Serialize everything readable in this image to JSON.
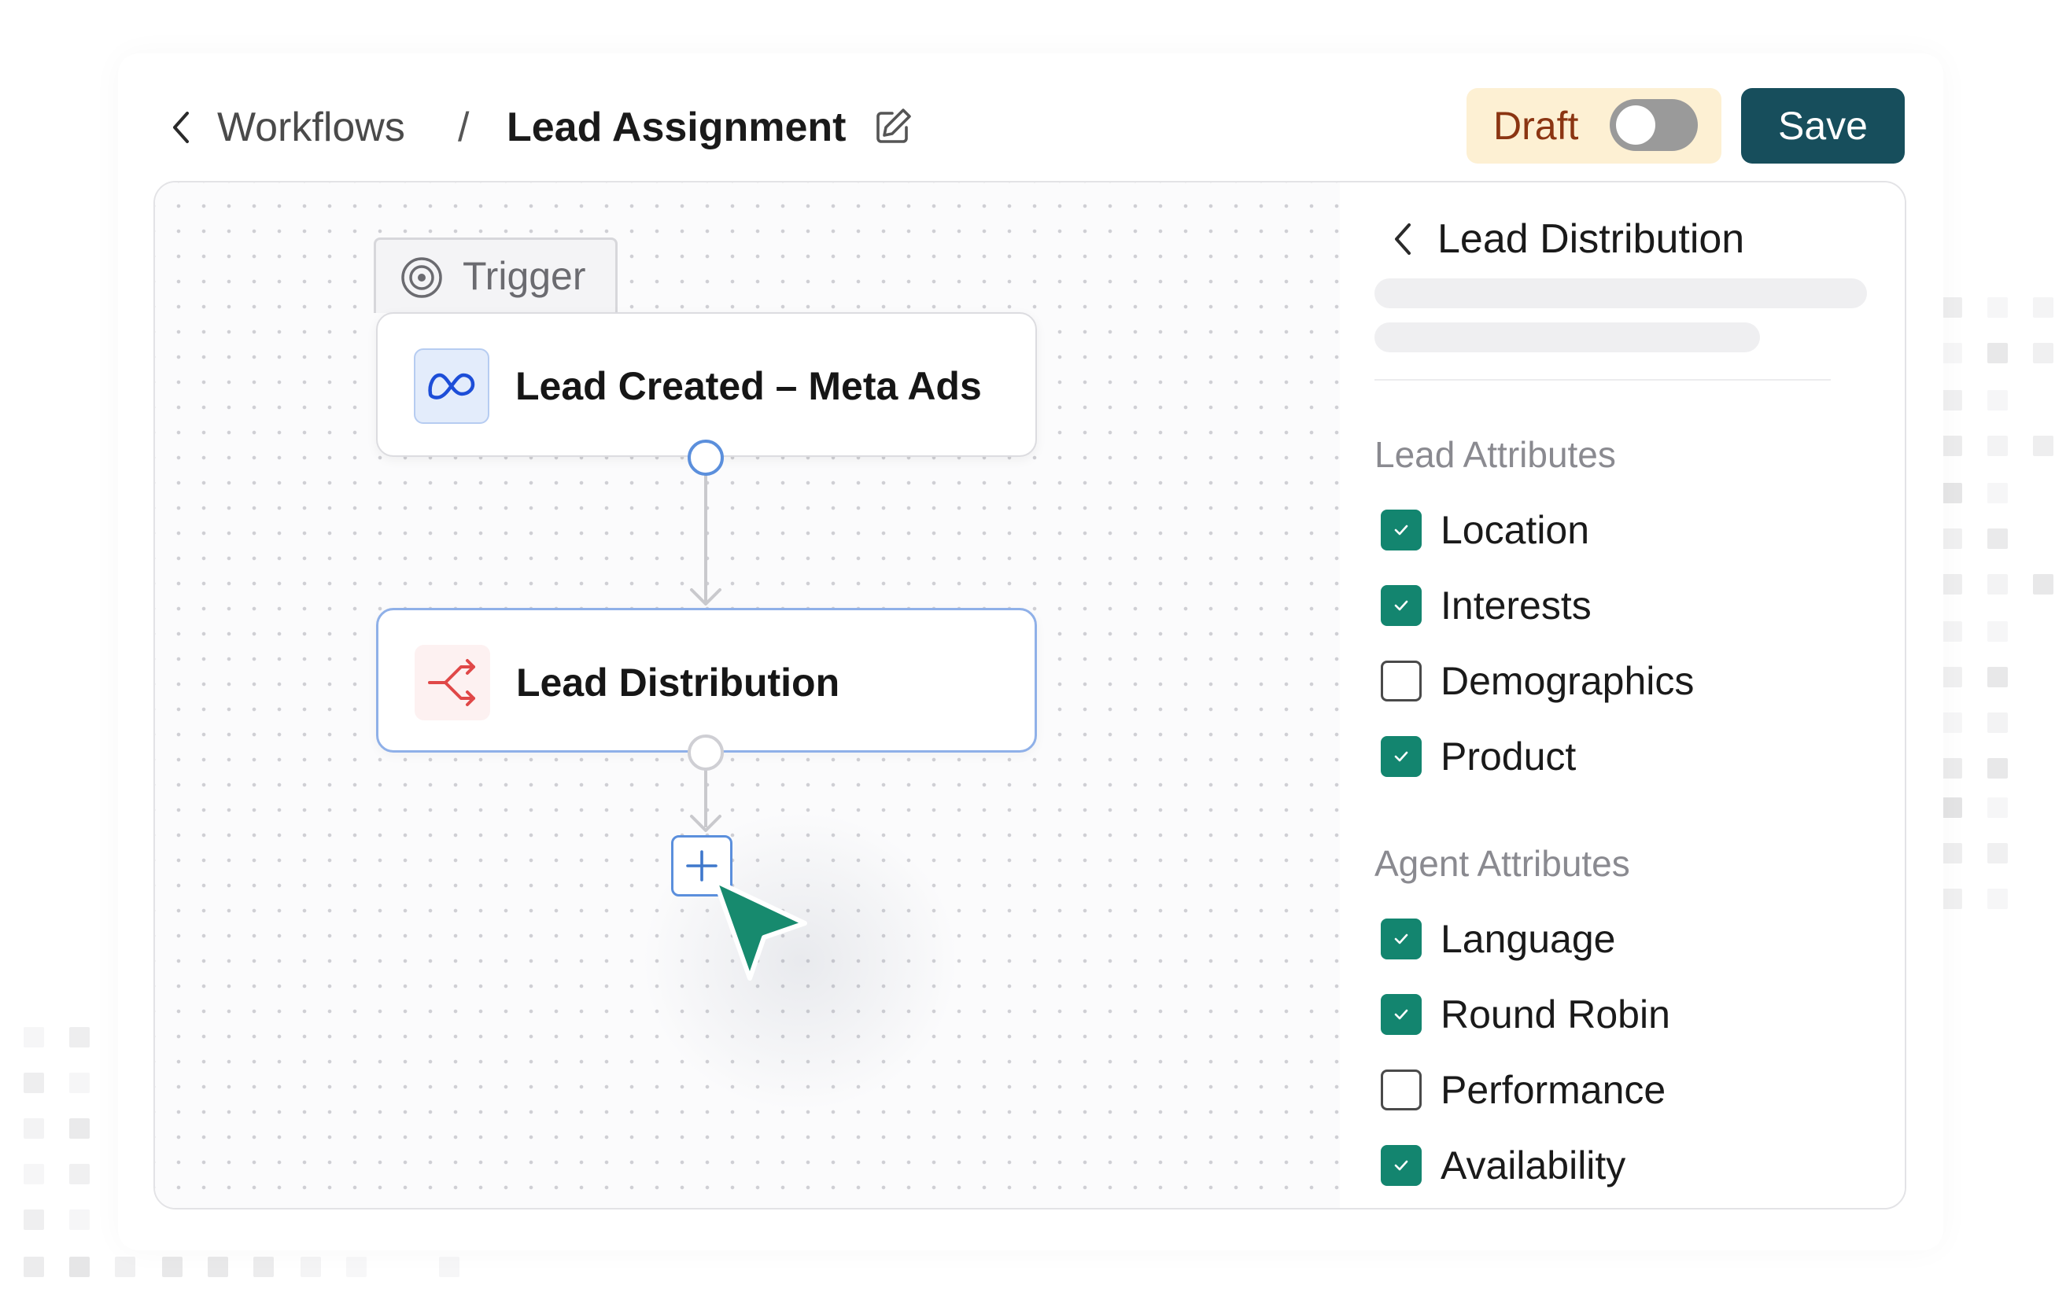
{
  "header": {
    "back_icon": "chevron-left-icon",
    "breadcrumb_parent": "Workflows",
    "breadcrumb_separator": "/",
    "workflow_title": "Lead Assignment",
    "edit_icon": "pencil-edit-icon",
    "status_label": "Draft",
    "status_toggle_on": false,
    "save_label": "Save"
  },
  "canvas": {
    "trigger_tab_label": "Trigger",
    "trigger_icon": "target-icon",
    "trigger_node": {
      "label": "Lead Created – Meta Ads",
      "icon": "meta-logo-icon"
    },
    "action_node": {
      "label": "Lead Distribution",
      "icon": "split-arrows-icon"
    },
    "add_icon": "plus-icon",
    "pointer_icon": "cursor-arrow-icon"
  },
  "panel": {
    "title": "Lead Distribution",
    "lead_section_title": "Lead Attributes",
    "lead_attributes": [
      {
        "label": "Location",
        "checked": true
      },
      {
        "label": "Interests",
        "checked": true
      },
      {
        "label": "Demographics",
        "checked": false
      },
      {
        "label": "Product",
        "checked": true
      }
    ],
    "agent_section_title": "Agent Attributes",
    "agent_attributes": [
      {
        "label": "Language",
        "checked": true
      },
      {
        "label": "Round Robin",
        "checked": true
      },
      {
        "label": "Performance",
        "checked": false
      },
      {
        "label": "Availability",
        "checked": true
      }
    ]
  },
  "colors": {
    "accent_green": "#13856f",
    "save_button": "#174e5c",
    "draft_bg": "#fdf0d3",
    "draft_text": "#8b3512",
    "node_selected_border": "#8fb0e8",
    "distribution_icon": "#e04848",
    "meta_icon": "#1d4ed8"
  }
}
